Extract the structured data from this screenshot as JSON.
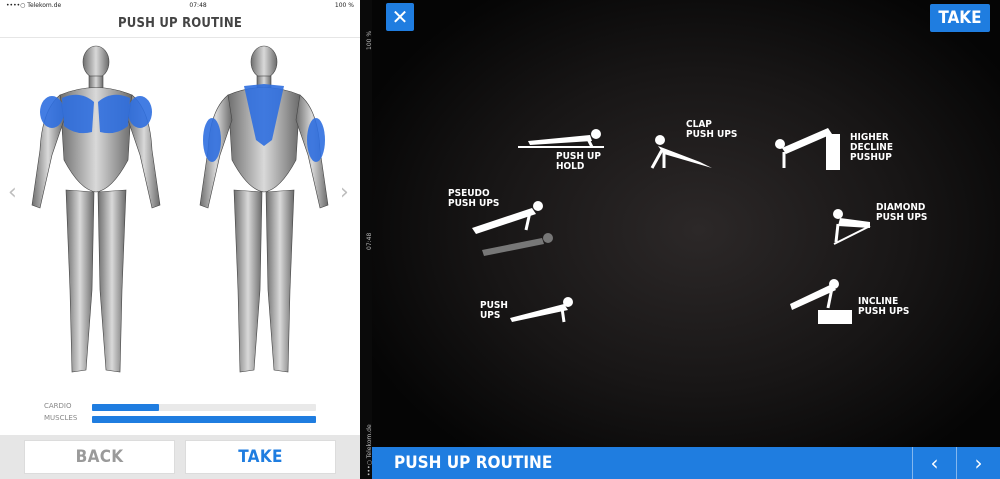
{
  "status": {
    "left": "••••○ Telekom.de",
    "time": "07:48",
    "battery": "100 %"
  },
  "left_panel": {
    "title": "PUSH UP ROUTINE",
    "prev_icon": "chevron-left-icon",
    "next_icon": "chevron-right-icon",
    "bars": [
      {
        "label": "CARDIO",
        "value": 0.3
      },
      {
        "label": "MUSCLES",
        "value": 1.0
      }
    ],
    "back_label": "BACK",
    "take_label": "TAKE"
  },
  "strip": {
    "battery": "100 %",
    "time": "07:48",
    "carrier": "•••○ Telekom.de"
  },
  "right_panel": {
    "close_icon": "close-icon",
    "take_label": "TAKE",
    "exercises": [
      {
        "name": "push-up-hold",
        "label": "PUSH UP\nHOLD"
      },
      {
        "name": "clap-push-ups",
        "label": "CLAP\nPUSH UPS"
      },
      {
        "name": "higher-decline-pushup",
        "label": "HIGHER\nDECLINE\nPUSHUP"
      },
      {
        "name": "pseudo-push-ups",
        "label": "PSEUDO\nPUSH UPS"
      },
      {
        "name": "diamond-push-ups",
        "label": "DIAMOND\nPUSH UPS"
      },
      {
        "name": "push-ups",
        "label": "PUSH\nUPS"
      },
      {
        "name": "incline-push-ups",
        "label": "INCLINE\nPUSH UPS"
      }
    ],
    "footer_title": "PUSH UP ROUTINE",
    "prev_icon": "chevron-left-icon",
    "next_icon": "chevron-right-icon"
  },
  "colors": {
    "accent": "#1f7de0",
    "muscle_highlight": "#2f6fe0",
    "background_dark": "#050505"
  }
}
